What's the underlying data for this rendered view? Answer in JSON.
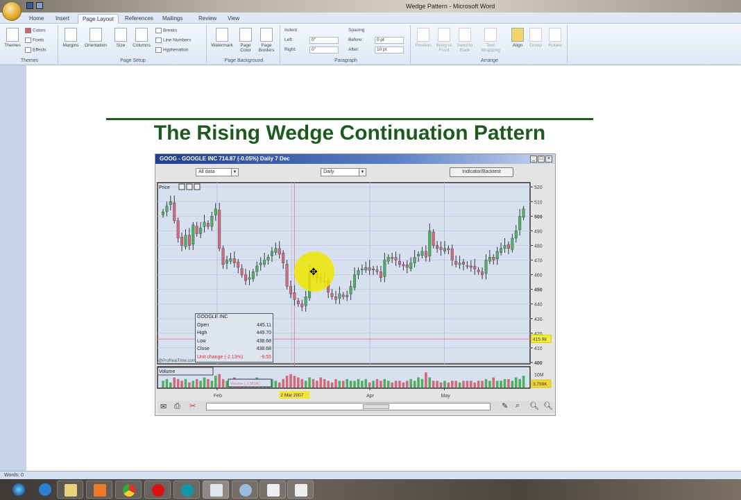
{
  "window": {
    "title": "Wedge Pattern - Microsoft Word"
  },
  "tabs": [
    "Home",
    "Insert",
    "Page Layout",
    "References",
    "Mailings",
    "Review",
    "View"
  ],
  "active_tab": "Page Layout",
  "ribbon": {
    "themes": {
      "label": "Themes",
      "themes_btn": "Themes",
      "colors": "Colors",
      "fonts": "Fonts",
      "effects": "Effects"
    },
    "page_setup": {
      "label": "Page Setup",
      "margins": "Margins",
      "orientation": "Orientation",
      "size": "Size",
      "columns": "Columns",
      "breaks": "Breaks",
      "line_numbers": "Line Numbers",
      "hyphenation": "Hyphenation"
    },
    "page_background": {
      "label": "Page Background",
      "watermark": "Watermark",
      "page_color": "Page Color",
      "page_borders": "Page Borders"
    },
    "paragraph": {
      "label": "Paragraph",
      "indent": "Indent",
      "left_label": "Left:",
      "left_value": "0\"",
      "right_label": "Right:",
      "right_value": "0\"",
      "spacing": "Spacing",
      "before_label": "Before:",
      "before_value": "0 pt",
      "after_label": "After:",
      "after_value": "10 pt"
    },
    "arrange": {
      "label": "Arrange",
      "position": "Position",
      "bring_front": "Bring to Front",
      "send_back": "Send to Back",
      "text_wrapping": "Text Wrapping",
      "align": "Align",
      "group": "Group",
      "rotate": "Rotate"
    }
  },
  "document": {
    "heading": "The Rising Wedge Continuation Pattern",
    "heading_color": "#1d5a1d"
  },
  "chart_window": {
    "title": "GOOG - GOOGLE INC   714.87 (-0.05%)   Daily  7 Dec",
    "range_select": "All data",
    "period_select": "Daily",
    "indicator_button": "Indicator/Backtest",
    "price_panel_label": "Price",
    "volume_panel_label": "Volume",
    "watermark": "@ProRealTime.com",
    "info": {
      "name": "GOOGLE INC",
      "rows": [
        [
          "Open",
          "445.11"
        ],
        [
          "High",
          "449.70"
        ],
        [
          "Low",
          "438.68"
        ],
        [
          "Close",
          "438.68"
        ],
        [
          "Unit change (-2.13%)",
          "-9.55"
        ]
      ]
    },
    "price_tag": "415.98",
    "volume_tag": "3,799K",
    "volume_tick": "10M",
    "volume_box": "Volume (-1,561K)",
    "date_tag": "2 Mar 2007"
  },
  "chart_data": {
    "type": "candlestick",
    "title": "GOOG - GOOGLE INC",
    "ylim": [
      400,
      522
    ],
    "yticks": [
      400,
      410,
      420,
      430,
      440,
      450,
      460,
      470,
      480,
      490,
      500,
      510,
      520
    ],
    "xticks": [
      "Feb",
      "Apr",
      "May"
    ],
    "up_color": "#4fae5f",
    "down_color": "#d06a7a",
    "closes": [
      503,
      507,
      510,
      497,
      485,
      480,
      487,
      480,
      494,
      488,
      492,
      496,
      493,
      500,
      505,
      478,
      467,
      470,
      471,
      468,
      465,
      460,
      456,
      458,
      462,
      466,
      468,
      470,
      472,
      476,
      478,
      474,
      468,
      452,
      447,
      443,
      440,
      438,
      445,
      462,
      460,
      458,
      456,
      455,
      448,
      445,
      443,
      447,
      445,
      446,
      452,
      460,
      463,
      464,
      465,
      463,
      464,
      462,
      458,
      470,
      472,
      471,
      470,
      467,
      466,
      465,
      468,
      472,
      474,
      476,
      472,
      490,
      480,
      478,
      477,
      478,
      477,
      470,
      467,
      468,
      467,
      466,
      465,
      464,
      462,
      460,
      470,
      472,
      470,
      476,
      478,
      480,
      478,
      485,
      490,
      500,
      505
    ],
    "volumes_m": [
      4,
      5,
      3,
      6,
      5,
      4,
      5,
      3,
      4,
      5,
      4,
      6,
      5,
      4,
      7,
      8,
      5,
      4,
      3,
      6,
      5,
      4,
      5,
      4,
      5,
      6,
      4,
      5,
      4,
      5,
      4,
      3,
      5,
      7,
      8,
      7,
      6,
      5,
      4,
      6,
      5,
      4,
      6,
      5,
      4,
      3,
      5,
      4,
      4,
      5,
      4,
      4,
      5,
      4,
      5,
      3,
      4,
      5,
      4,
      5,
      4,
      3,
      4,
      4,
      3,
      4,
      5,
      4,
      6,
      5,
      9,
      6,
      4,
      4,
      3,
      4,
      3,
      4,
      4,
      3,
      4,
      4,
      4,
      3,
      4,
      4,
      5,
      4,
      6,
      4,
      4,
      5,
      5,
      4,
      6,
      5,
      7
    ]
  },
  "status_bar": {
    "words": "Words: 0"
  },
  "taskbar": [
    "start",
    "internet-explorer",
    "file-explorer",
    "media-player",
    "chrome",
    "opera",
    "skype",
    "word",
    "paint",
    "camtasia",
    "recorder"
  ]
}
